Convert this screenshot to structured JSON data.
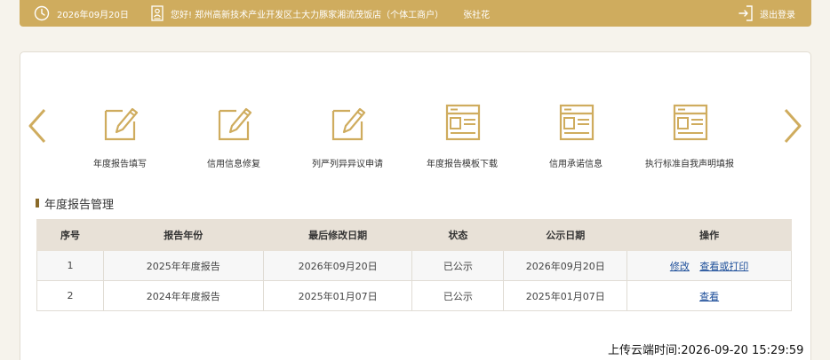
{
  "colors": {
    "accent": "#cfac5e",
    "link": "#1e4f9a",
    "header_row": "#e8e1d7"
  },
  "topbar": {
    "clock_icon": "clock-icon",
    "date": "2026年09月20日",
    "user_icon": "id-card-icon",
    "greeting": "您好!  郑州高新技术产业开发区土大力豚家湘流茂饭店（个体工商户）",
    "user_name": "张社花",
    "logout_icon": "logout-icon",
    "logout_label": "退出登录"
  },
  "carousel": {
    "prev_icon": "chevron-left-icon",
    "next_icon": "chevron-right-icon",
    "items": [
      {
        "label": "年度报告填写",
        "icon": "edit-icon"
      },
      {
        "label": "信用信息修复",
        "icon": "edit-icon"
      },
      {
        "label": "列严列异异议申请",
        "icon": "edit-icon"
      },
      {
        "label": "年度报告模板下载",
        "icon": "form-icon"
      },
      {
        "label": "信用承诺信息",
        "icon": "form-icon"
      },
      {
        "label": "执行标准自我声明填报",
        "icon": "form-icon"
      }
    ]
  },
  "section": {
    "title": "年度报告管理"
  },
  "table": {
    "headers": [
      "序号",
      "报告年份",
      "最后修改日期",
      "状态",
      "公示日期",
      "操作"
    ],
    "rows": [
      {
        "no": "1",
        "year": "2025年年度报告",
        "modified": "2026年09月20日",
        "status": "已公示",
        "published": "2026年09月20日",
        "actions": [
          "修改",
          "查看或打印"
        ]
      },
      {
        "no": "2",
        "year": "2024年年度报告",
        "modified": "2025年01月07日",
        "status": "已公示",
        "published": "2025年01月07日",
        "actions": [
          "查看"
        ]
      }
    ]
  },
  "upload_time": "上传云端时间:2026-09-20 15:29:59"
}
